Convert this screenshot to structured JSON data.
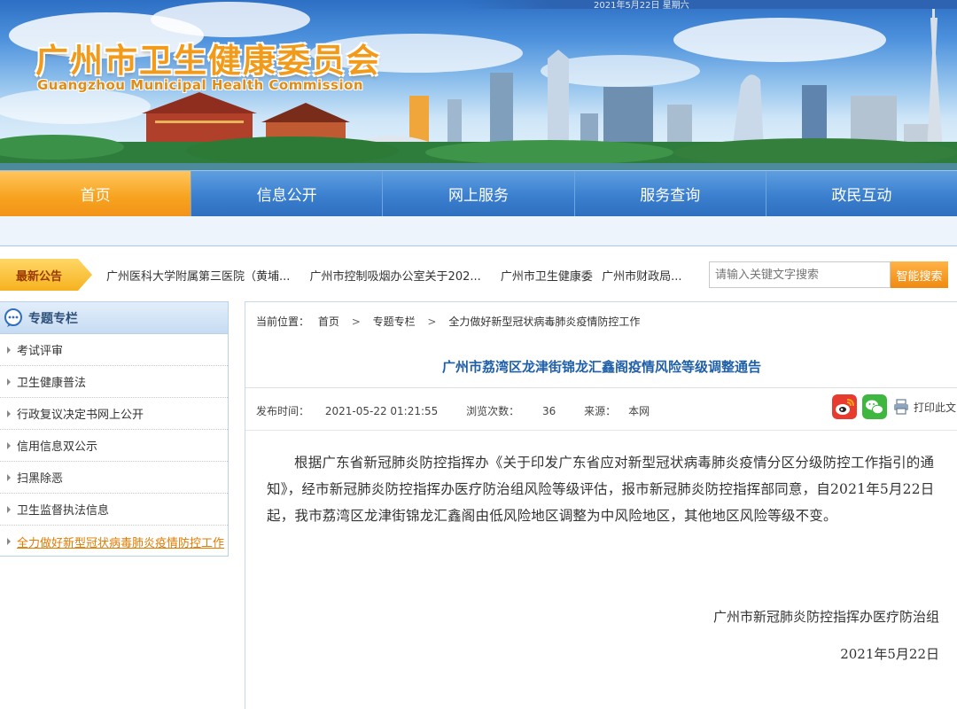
{
  "header": {
    "site_title": "广州市卫生健康委员会",
    "site_subtitle": "Guangzhou Municipal Health Commission",
    "top_strip_text": "2021年5月22日 星期六"
  },
  "nav": {
    "items": [
      {
        "label": "首页",
        "active": true
      },
      {
        "label": "信息公开",
        "active": false
      },
      {
        "label": "网上服务",
        "active": false
      },
      {
        "label": "服务查询",
        "active": false
      },
      {
        "label": "政民互动",
        "active": false
      }
    ]
  },
  "notice": {
    "tag": "最新公告",
    "links": [
      "广州医科大学附属第三医院（黄埔...",
      "广州市控制吸烟办公室关于202...",
      "广州市卫生健康委",
      "广州市财政局..."
    ]
  },
  "search": {
    "placeholder": "请输入关键文字搜索",
    "button": "智能搜索"
  },
  "sidebar": {
    "title": "专题专栏",
    "items": [
      {
        "label": "考试评审",
        "current": false
      },
      {
        "label": "卫生健康普法",
        "current": false
      },
      {
        "label": "行政复议决定书网上公开",
        "current": false
      },
      {
        "label": "信用信息双公示",
        "current": false
      },
      {
        "label": "扫黑除恶",
        "current": false
      },
      {
        "label": "卫生监督执法信息",
        "current": false
      },
      {
        "label": "全力做好新型冠状病毒肺炎疫情防控工作",
        "current": true
      }
    ]
  },
  "breadcrumb": {
    "prefix": "当前位置：",
    "items": [
      "首页",
      "专题专栏",
      "全力做好新型冠状病毒肺炎疫情防控工作"
    ],
    "separator": ">"
  },
  "article": {
    "title": "广州市荔湾区龙津街锦龙汇鑫阁疫情风险等级调整通告",
    "publish_label": "发布时间：",
    "publish_time": "2021-05-22 01:21:55",
    "views_label": "浏览次数：",
    "views": "36",
    "source_label": "来源：",
    "source": "本网",
    "print_label": "打印此文",
    "body": "根据广东省新冠肺炎防控指挥办《关于印发广东省应对新型冠状病毒肺炎疫情分区分级防控工作指引的通知》，经市新冠肺炎防控指挥办医疗防治组风险等级评估，报市新冠肺炎防控指挥部同意，自2021年5月22日起，我市荔湾区龙津街锦龙汇鑫阁由低风险地区调整为中风险地区，其他地区风险等级不变。",
    "signature": "广州市新冠肺炎防控指挥办医疗防治组",
    "date": "2021年5月22日"
  },
  "icons": {
    "weibo": "weibo-icon",
    "wechat": "wechat-icon",
    "print": "printer-icon",
    "sidebar_header": "speech-bubble-icon"
  },
  "colors": {
    "nav_blue": "#3b7fcf",
    "nav_active": "#f7a21e",
    "title_blue": "#1f5fa8",
    "accent_orange": "#f08a10"
  }
}
